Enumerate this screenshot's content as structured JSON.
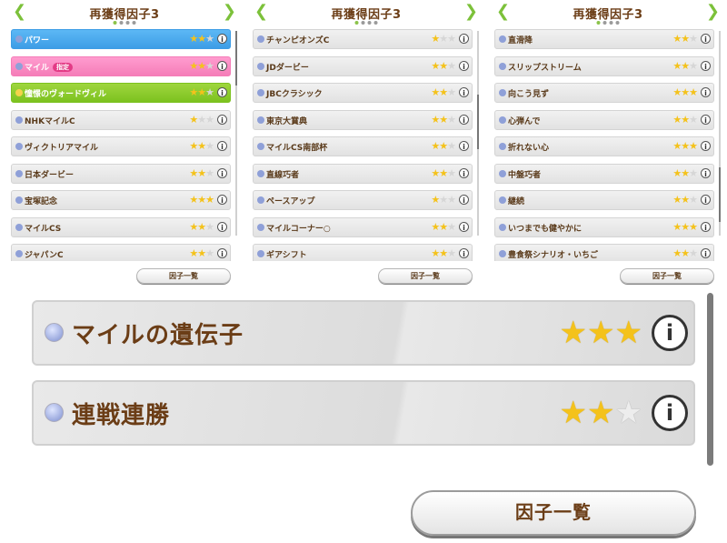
{
  "panels": [
    {
      "title": "再獲得因子3",
      "button": "因子一覧",
      "rows": [
        {
          "name": "パワー",
          "stars": 2,
          "style": "blue",
          "tag": ""
        },
        {
          "name": "マイル",
          "stars": 2,
          "style": "pink",
          "tag": "指定"
        },
        {
          "name": "憧憬のヴォードヴィル",
          "stars": 2,
          "style": "green",
          "tag": ""
        },
        {
          "name": "NHKマイルC",
          "stars": 1,
          "style": "",
          "tag": ""
        },
        {
          "name": "ヴィクトリアマイル",
          "stars": 2,
          "style": "",
          "tag": ""
        },
        {
          "name": "日本ダービー",
          "stars": 2,
          "style": "",
          "tag": ""
        },
        {
          "name": "宝塚記念",
          "stars": 3,
          "style": "",
          "tag": ""
        },
        {
          "name": "マイルCS",
          "stars": 2,
          "style": "",
          "tag": ""
        },
        {
          "name": "ジャパンC",
          "stars": 2,
          "style": "",
          "tag": ""
        }
      ]
    },
    {
      "title": "再獲得因子3",
      "button": "因子一覧",
      "rows": [
        {
          "name": "チャンピオンズC",
          "stars": 1,
          "style": "",
          "tag": ""
        },
        {
          "name": "JDダービー",
          "stars": 2,
          "style": "",
          "tag": ""
        },
        {
          "name": "JBCクラシック",
          "stars": 2,
          "style": "",
          "tag": ""
        },
        {
          "name": "東京大賞典",
          "stars": 2,
          "style": "",
          "tag": ""
        },
        {
          "name": "マイルCS南部杯",
          "stars": 2,
          "style": "",
          "tag": ""
        },
        {
          "name": "直線巧者",
          "stars": 2,
          "style": "",
          "tag": ""
        },
        {
          "name": "ペースアップ",
          "stars": 1,
          "style": "",
          "tag": ""
        },
        {
          "name": "マイルコーナー○",
          "stars": 2,
          "style": "",
          "tag": ""
        },
        {
          "name": "ギアシフト",
          "stars": 2,
          "style": "",
          "tag": ""
        }
      ]
    },
    {
      "title": "再獲得因子3",
      "button": "因子一覧",
      "rows": [
        {
          "name": "直滑降",
          "stars": 2,
          "style": "",
          "tag": ""
        },
        {
          "name": "スリップストリーム",
          "stars": 2,
          "style": "",
          "tag": ""
        },
        {
          "name": "向こう見ず",
          "stars": 3,
          "style": "",
          "tag": ""
        },
        {
          "name": "心弾んで",
          "stars": 2,
          "style": "",
          "tag": ""
        },
        {
          "name": "折れない心",
          "stars": 3,
          "style": "",
          "tag": ""
        },
        {
          "name": "中盤巧者",
          "stars": 2,
          "style": "",
          "tag": ""
        },
        {
          "name": "継続",
          "stars": 2,
          "style": "",
          "tag": ""
        },
        {
          "name": "いつまでも健やかに",
          "stars": 3,
          "style": "",
          "tag": ""
        },
        {
          "name": "豊食祭シナリオ・いちご",
          "stars": 2,
          "style": "",
          "tag": ""
        }
      ]
    }
  ],
  "main": {
    "rows": [
      {
        "name": "マイルの遺伝子",
        "stars": 3
      },
      {
        "name": "連戦連勝",
        "stars": 2
      }
    ],
    "button": "因子一覧"
  },
  "icons": {
    "prev": "chevron-left-icon",
    "next": "chevron-right-icon",
    "info": "info-icon",
    "star": "star-icon"
  },
  "colors": {
    "accent": "#7cc13a",
    "text": "#6b3d16",
    "star": "#f4c21b",
    "blue": "#3d9de6",
    "pink": "#f57db8",
    "green": "#7cc21f"
  }
}
